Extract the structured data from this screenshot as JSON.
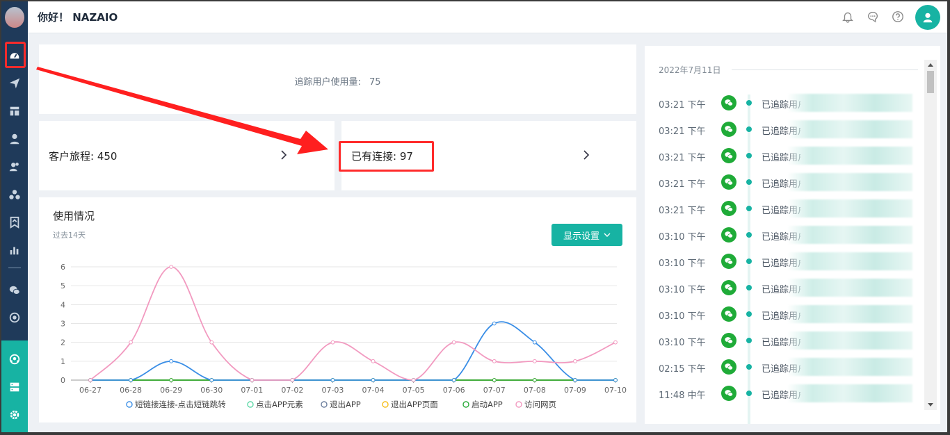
{
  "header": {
    "greeting": "你好！ NAZAIO"
  },
  "usage": {
    "label": "追踪用户使用量:",
    "value": "75"
  },
  "stats": {
    "journey_label": "客户旅程: 450",
    "connections_label": "已有连接: 97"
  },
  "chart_card": {
    "title": "使用情况",
    "subtitle": "过去14天",
    "settings_button": "显示设置"
  },
  "chart_data": {
    "type": "line",
    "categories": [
      "06-27",
      "06-28",
      "06-29",
      "06-30",
      "07-01",
      "07-02",
      "07-03",
      "07-04",
      "07-05",
      "07-06",
      "07-07",
      "07-08",
      "07-09",
      "07-10"
    ],
    "ylim": [
      0,
      6
    ],
    "yticks": [
      "0",
      "1",
      "2",
      "3",
      "4",
      "5",
      "6"
    ],
    "series": [
      {
        "name": "短链接连接-点击短链跳转",
        "color": "#3a8ee6",
        "values": [
          0,
          0,
          1,
          0,
          0,
          0,
          0,
          0,
          0,
          0,
          3,
          2,
          0,
          0
        ]
      },
      {
        "name": "点击APP元素",
        "color": "#5ad8a6",
        "values": [
          0,
          0,
          0,
          0,
          0,
          0,
          0,
          0,
          0,
          0,
          0,
          0,
          0,
          0
        ]
      },
      {
        "name": "退出APP",
        "color": "#6d7f9e",
        "values": [
          0,
          0,
          0,
          0,
          0,
          0,
          0,
          0,
          0,
          0,
          0,
          0,
          0,
          0
        ]
      },
      {
        "name": "退出APP页面",
        "color": "#f6bd16",
        "values": [
          0,
          0,
          0,
          0,
          0,
          0,
          0,
          0,
          0,
          0,
          0,
          0,
          0,
          0
        ]
      },
      {
        "name": "启动APP",
        "color": "#2bab3a",
        "values": [
          0,
          0,
          0,
          0,
          0,
          0,
          0,
          0,
          0,
          0,
          0,
          0,
          0,
          0
        ]
      },
      {
        "name": "访问网页",
        "color": "#f29ac0",
        "values": [
          0,
          2,
          6,
          2,
          0,
          0,
          2,
          1,
          0,
          2,
          1,
          1,
          1,
          2
        ]
      }
    ],
    "legend_position": "bottom",
    "grid": true
  },
  "timeline": {
    "date": "2022年7月11日",
    "entries": [
      {
        "time": "03:21 下午",
        "text": "已追踪用户"
      },
      {
        "time": "03:21 下午",
        "text": "已追踪用户"
      },
      {
        "time": "03:21 下午",
        "text": "已追踪用户"
      },
      {
        "time": "03:21 下午",
        "text": "已追踪用户"
      },
      {
        "time": "03:21 下午",
        "text": "已追踪用户"
      },
      {
        "time": "03:10 下午",
        "text": "已追踪用户"
      },
      {
        "time": "03:10 下午",
        "text": "已追踪用户"
      },
      {
        "time": "03:10 下午",
        "text": "已追踪用户"
      },
      {
        "time": "03:10 下午",
        "text": "已追踪用户"
      },
      {
        "time": "03:10 下午",
        "text": "已追踪用户"
      },
      {
        "time": "02:15 下午",
        "text": "已追踪用户"
      },
      {
        "time": "11:48 中午",
        "text": "已追踪用户"
      }
    ]
  },
  "icons": {
    "sidebar": [
      "dashboard-icon",
      "send-icon",
      "layout-icon",
      "user-icon",
      "users-icon",
      "segments-icon",
      "bookmark-icon",
      "bar-chart-icon",
      "wechat-icon",
      "circle-target-icon",
      "team-icon",
      "server-icon",
      "gear-icon"
    ],
    "topbar": [
      "bell-icon",
      "chat-icon",
      "help-icon",
      "avatar-icon"
    ]
  },
  "colors": {
    "accent": "#17b3a3",
    "sidebar": "#1f3a5a",
    "highlight": "#ff2b2b",
    "wechat": "#1fab38"
  }
}
